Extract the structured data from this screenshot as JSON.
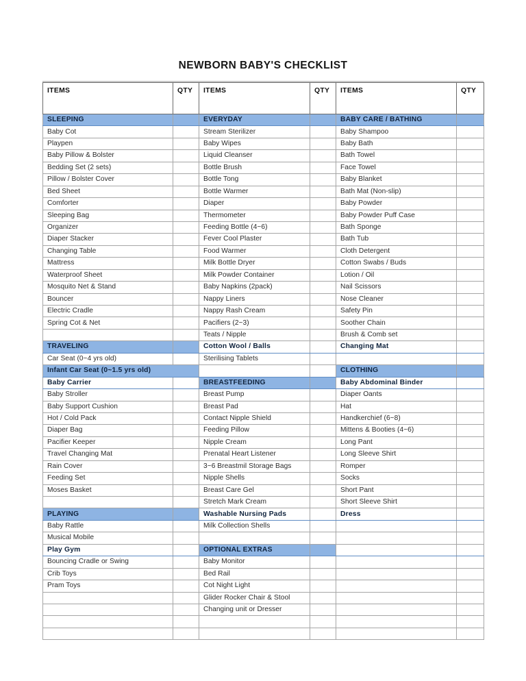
{
  "document": {
    "title": "NEWBORN BABY'S CHECKLIST"
  },
  "table": {
    "headers": [
      "ITEMS",
      "QTY",
      "ITEMS",
      "QTY",
      "ITEMS",
      "QTY"
    ],
    "colors": {
      "section_header_bg": "#8eb4e3",
      "section_header_text": "#10243e",
      "grid_line": "#a6a6a6",
      "title_rule": "#c9c9c9"
    },
    "sections": {
      "col1": [
        {
          "name": "SLEEPING",
          "items": [
            "Baby Cot",
            "Playpen",
            "Baby Pillow & Bolster",
            "Bedding Set (2 sets)",
            "Pillow / Bolster Cover",
            "Bed Sheet",
            "Comforter",
            "Sleeping Bag",
            "Organizer",
            "Diaper Stacker",
            "Changing Table",
            "Mattress",
            "Waterproof Sheet",
            "Mosquito Net & Stand",
            "Bouncer",
            "Electric Cradle",
            "Spring Cot & Net"
          ]
        },
        {
          "name": "TRAVELING",
          "items": [
            "Car Seat (0~4 yrs old)",
            "Infant Car Seat (0~1.5 yrs old)",
            "Baby Carrier",
            "Baby Stroller",
            "Baby Support Cushion",
            "Hot / Cold Pack",
            "Diaper Bag",
            "Pacifier Keeper",
            "Travel Changing Mat",
            "Rain Cover",
            "Feeding Set",
            "Moses Basket"
          ]
        },
        {
          "name": "PLAYING",
          "items": [
            "Baby Rattle",
            "Musical Mobile",
            "Play Gym",
            "Bouncing Cradle or Swing",
            "Crib Toys",
            "Pram Toys"
          ]
        }
      ],
      "col2": [
        {
          "name": "EVERYDAY",
          "items": [
            "Stream Sterilizer",
            "Baby Wipes",
            "Liquid Cleanser",
            "Bottle Brush",
            "Bottle Tong",
            "Bottle Warmer",
            "Diaper",
            "Thermometer",
            "Feeding Bottle (4~6)",
            "Fever Cool Plaster",
            "Food Warmer",
            "Milk Bottle Dryer",
            "Milk Powder Container",
            "Baby Napkins (2pack)",
            "Nappy Liners",
            "Nappy Rash Cream",
            "Pacifiers (2~3)",
            "Teats / Nipple",
            "Cotton Wool / Balls",
            "Sterilising Tablets"
          ]
        },
        {
          "name": "BREASTFEEDING",
          "items": [
            "Breast Pump",
            "Breast Pad",
            "Contact Nipple Shield",
            "Feeding Pillow",
            "Nipple Cream",
            "Prenatal Heart Listener",
            "3~6 Breastmil Storage Bags",
            "Nipple Shells",
            "Breast Care Gel",
            "Stretch Mark Cream",
            "Washable Nursing Pads",
            "Milk Collection Shells"
          ]
        },
        {
          "name": "OPTIONAL EXTRAS",
          "items": [
            "Baby Monitor",
            "Bed Rail",
            "Cot Night Light",
            "Glider Rocker Chair & Stool",
            "Changing unit or Dresser"
          ]
        }
      ],
      "col3": [
        {
          "name": "BABY CARE / BATHING",
          "items": [
            "Baby Shampoo",
            "Baby Bath",
            "Bath Towel",
            "Face Towel",
            "Baby Blanket",
            "Bath Mat (Non-slip)",
            "Baby Powder",
            "Baby Powder Puff Case",
            "Bath Sponge",
            "Bath Tub",
            "Cloth Detergent",
            "Cotton Swabs / Buds",
            "Lotion / Oil",
            "Nail Scissors",
            "Nose Cleaner",
            "Safety Pin",
            "Soother Chain",
            "Brush & Comb set",
            "Changing Mat"
          ]
        },
        {
          "name": "CLOTHING",
          "items": [
            "Baby Abdominal Binder",
            "Diaper Oants",
            "Hat",
            "Handkerchief (6~8)",
            "Mittens & Booties (4~6)",
            "Long Pant",
            "Long Sleeve Shirt",
            "Romper",
            "Socks",
            "Short Pant",
            "Short Sleeve Shirt",
            "Dress"
          ]
        }
      ]
    },
    "grid": {
      "row_count": 44,
      "col1": [
        {
          "t": "section",
          "v": "SLEEPING"
        },
        {
          "t": "item",
          "v": "Baby Cot"
        },
        {
          "t": "item",
          "v": "Playpen"
        },
        {
          "t": "item",
          "v": "Baby Pillow & Bolster"
        },
        {
          "t": "item",
          "v": "Bedding Set (2 sets)"
        },
        {
          "t": "item",
          "v": "Pillow / Bolster Cover"
        },
        {
          "t": "item",
          "v": "Bed Sheet"
        },
        {
          "t": "item",
          "v": "Comforter"
        },
        {
          "t": "item",
          "v": "Sleeping Bag"
        },
        {
          "t": "item",
          "v": "Organizer"
        },
        {
          "t": "item",
          "v": "Diaper Stacker"
        },
        {
          "t": "item",
          "v": "Changing Table"
        },
        {
          "t": "item",
          "v": "Mattress"
        },
        {
          "t": "item",
          "v": "Waterproof Sheet"
        },
        {
          "t": "item",
          "v": "Mosquito Net & Stand"
        },
        {
          "t": "item",
          "v": "Bouncer"
        },
        {
          "t": "item",
          "v": "Electric Cradle"
        },
        {
          "t": "item",
          "v": "Spring Cot & Net"
        },
        {
          "t": "blank",
          "v": ""
        },
        {
          "t": "section",
          "v": "TRAVELING"
        },
        {
          "t": "item",
          "v": "Car Seat (0~4 yrs old)"
        },
        {
          "t": "merged",
          "v": "Infant Car Seat (0~1.5 yrs old)"
        },
        {
          "t": "item",
          "v": "Baby Carrier"
        },
        {
          "t": "item",
          "v": "Baby Stroller"
        },
        {
          "t": "item",
          "v": "Baby Support Cushion"
        },
        {
          "t": "item",
          "v": "Hot / Cold Pack"
        },
        {
          "t": "item",
          "v": "Diaper Bag"
        },
        {
          "t": "item",
          "v": "Pacifier Keeper"
        },
        {
          "t": "item",
          "v": "Travel Changing Mat"
        },
        {
          "t": "item",
          "v": "Rain Cover"
        },
        {
          "t": "item",
          "v": "Feeding Set"
        },
        {
          "t": "item",
          "v": "Moses Basket"
        },
        {
          "t": "blank",
          "v": ""
        },
        {
          "t": "section",
          "v": "PLAYING"
        },
        {
          "t": "item",
          "v": "Baby Rattle"
        },
        {
          "t": "item",
          "v": "Musical Mobile"
        },
        {
          "t": "item",
          "v": "Play Gym"
        },
        {
          "t": "item",
          "v": "Bouncing Cradle or Swing"
        },
        {
          "t": "item",
          "v": "Crib Toys"
        },
        {
          "t": "item",
          "v": "Pram Toys"
        },
        {
          "t": "blank",
          "v": ""
        },
        {
          "t": "blank",
          "v": ""
        },
        {
          "t": "blank",
          "v": ""
        },
        {
          "t": "blank",
          "v": ""
        }
      ],
      "col2": [
        {
          "t": "section",
          "v": "EVERYDAY"
        },
        {
          "t": "item",
          "v": "Stream Sterilizer"
        },
        {
          "t": "item",
          "v": "Baby Wipes"
        },
        {
          "t": "item",
          "v": "Liquid Cleanser"
        },
        {
          "t": "item",
          "v": "Bottle Brush"
        },
        {
          "t": "item",
          "v": "Bottle Tong"
        },
        {
          "t": "item",
          "v": "Bottle Warmer"
        },
        {
          "t": "item",
          "v": "Diaper"
        },
        {
          "t": "item",
          "v": "Thermometer"
        },
        {
          "t": "item",
          "v": "Feeding Bottle (4~6)"
        },
        {
          "t": "item",
          "v": "Fever Cool Plaster"
        },
        {
          "t": "item",
          "v": "Food Warmer"
        },
        {
          "t": "item",
          "v": "Milk Bottle Dryer"
        },
        {
          "t": "item",
          "v": "Milk Powder Container"
        },
        {
          "t": "item",
          "v": "Baby Napkins (2pack)"
        },
        {
          "t": "item",
          "v": "Nappy Liners"
        },
        {
          "t": "item",
          "v": "Nappy Rash Cream"
        },
        {
          "t": "item",
          "v": "Pacifiers (2~3)"
        },
        {
          "t": "item",
          "v": "Teats / Nipple"
        },
        {
          "t": "item",
          "v": "Cotton Wool / Balls"
        },
        {
          "t": "item",
          "v": "Sterilising Tablets"
        },
        {
          "t": "blank",
          "v": ""
        },
        {
          "t": "section",
          "v": "BREASTFEEDING"
        },
        {
          "t": "item",
          "v": "Breast Pump"
        },
        {
          "t": "item",
          "v": "Breast Pad"
        },
        {
          "t": "item",
          "v": "Contact Nipple Shield"
        },
        {
          "t": "item",
          "v": "Feeding Pillow"
        },
        {
          "t": "item",
          "v": "Nipple Cream"
        },
        {
          "t": "item",
          "v": "Prenatal Heart Listener"
        },
        {
          "t": "item",
          "v": "3~6 Breastmil Storage Bags"
        },
        {
          "t": "item",
          "v": "Nipple Shells"
        },
        {
          "t": "item",
          "v": "Breast Care Gel"
        },
        {
          "t": "item",
          "v": "Stretch Mark Cream"
        },
        {
          "t": "item",
          "v": "Washable Nursing Pads"
        },
        {
          "t": "item",
          "v": "Milk Collection Shells"
        },
        {
          "t": "blank",
          "v": ""
        },
        {
          "t": "section",
          "v": "OPTIONAL EXTRAS"
        },
        {
          "t": "item",
          "v": "Baby Monitor"
        },
        {
          "t": "item",
          "v": "Bed Rail"
        },
        {
          "t": "item",
          "v": "Cot Night Light"
        },
        {
          "t": "item",
          "v": "Glider Rocker Chair & Stool"
        },
        {
          "t": "item",
          "v": "Changing unit or Dresser"
        },
        {
          "t": "blank",
          "v": ""
        },
        {
          "t": "blank",
          "v": ""
        }
      ],
      "col3": [
        {
          "t": "section",
          "v": "BABY CARE / BATHING"
        },
        {
          "t": "item",
          "v": "Baby Shampoo"
        },
        {
          "t": "item",
          "v": "Baby Bath"
        },
        {
          "t": "item",
          "v": "Bath Towel"
        },
        {
          "t": "item",
          "v": "Face Towel"
        },
        {
          "t": "item",
          "v": "Baby Blanket"
        },
        {
          "t": "item",
          "v": "Bath Mat (Non-slip)"
        },
        {
          "t": "item",
          "v": "Baby Powder"
        },
        {
          "t": "item",
          "v": "Baby Powder Puff Case"
        },
        {
          "t": "item",
          "v": "Bath Sponge"
        },
        {
          "t": "item",
          "v": "Bath Tub"
        },
        {
          "t": "item",
          "v": "Cloth Detergent"
        },
        {
          "t": "item",
          "v": "Cotton Swabs / Buds"
        },
        {
          "t": "item",
          "v": "Lotion / Oil"
        },
        {
          "t": "item",
          "v": "Nail Scissors"
        },
        {
          "t": "item",
          "v": "Nose Cleaner"
        },
        {
          "t": "item",
          "v": "Safety Pin"
        },
        {
          "t": "item",
          "v": "Soother Chain"
        },
        {
          "t": "item",
          "v": "Brush & Comb set"
        },
        {
          "t": "item",
          "v": "Changing Mat"
        },
        {
          "t": "blank",
          "v": ""
        },
        {
          "t": "section",
          "v": "CLOTHING"
        },
        {
          "t": "item",
          "v": "Baby Abdominal Binder"
        },
        {
          "t": "item",
          "v": "Diaper Oants"
        },
        {
          "t": "item",
          "v": "Hat"
        },
        {
          "t": "item",
          "v": "Handkerchief (6~8)"
        },
        {
          "t": "item",
          "v": "Mittens & Booties (4~6)"
        },
        {
          "t": "item",
          "v": "Long Pant"
        },
        {
          "t": "item",
          "v": "Long Sleeve Shirt"
        },
        {
          "t": "item",
          "v": "Romper"
        },
        {
          "t": "item",
          "v": "Socks"
        },
        {
          "t": "item",
          "v": "Short Pant"
        },
        {
          "t": "item",
          "v": "Short Sleeve Shirt"
        },
        {
          "t": "item",
          "v": "Dress"
        },
        {
          "t": "blank",
          "v": ""
        },
        {
          "t": "blank",
          "v": ""
        },
        {
          "t": "blank",
          "v": ""
        },
        {
          "t": "blank",
          "v": ""
        },
        {
          "t": "blank",
          "v": ""
        },
        {
          "t": "blank",
          "v": ""
        },
        {
          "t": "blank",
          "v": ""
        },
        {
          "t": "blank",
          "v": ""
        },
        {
          "t": "blank",
          "v": ""
        },
        {
          "t": "blank",
          "v": ""
        }
      ]
    }
  }
}
